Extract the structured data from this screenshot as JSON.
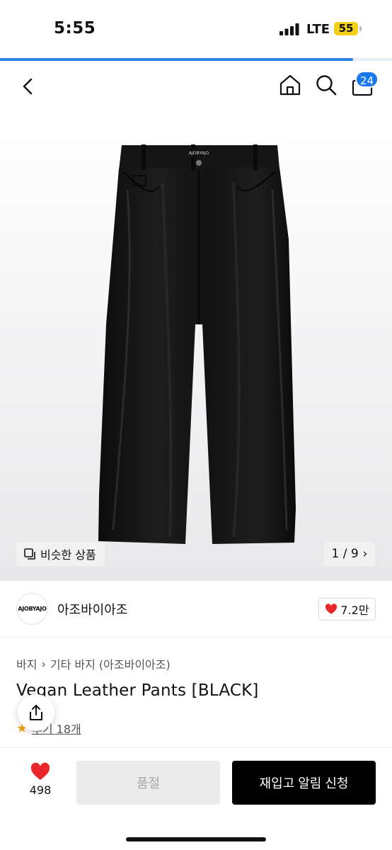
{
  "status_bar": {
    "time": "5:55",
    "network": "LTE",
    "battery": "55",
    "battery_color": "#f4cf19"
  },
  "page_progress": 0.9,
  "nav": {
    "back_icon": "chevron-left-icon",
    "home_icon": "home-icon",
    "search_icon": "search-icon",
    "cart_icon": "shopping-bag-icon",
    "cart_count": "24"
  },
  "gallery": {
    "similar_label": "비슷한 상품",
    "pager": "1 / 9",
    "pager_arrow": "›",
    "waistband_label": "AJOBYAJO"
  },
  "brand": {
    "logo_text": "AJOBYAJO",
    "name": "아조바이아조",
    "likes": "7.2만"
  },
  "product": {
    "breadcrumb": [
      "바지",
      "기타 바지 (아조바이아조)"
    ],
    "breadcrumb_separator": "›",
    "title": "Vegan Leather Pants [BLACK]",
    "review_label": "후기 18개"
  },
  "bottom": {
    "wish_count": "498",
    "soldout_label": "품절",
    "restock_label": "재입고 알림 신청"
  },
  "colors": {
    "accent_blue": "#1b79f0",
    "heart_red": "#e8262b",
    "primary_button": "#000000"
  }
}
